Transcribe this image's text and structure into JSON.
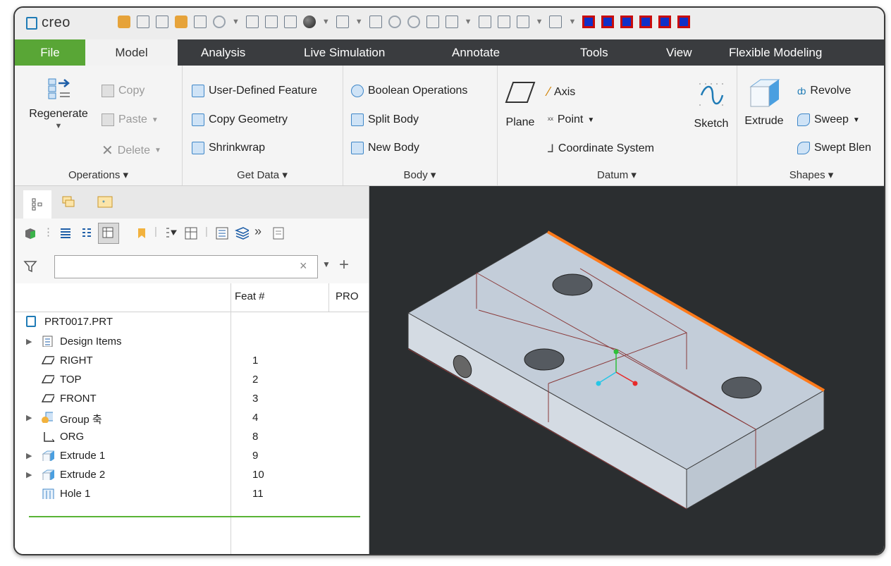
{
  "app": {
    "name": "creo"
  },
  "tabs": [
    {
      "label": "File"
    },
    {
      "label": "Model"
    },
    {
      "label": "Analysis"
    },
    {
      "label": "Live Simulation"
    },
    {
      "label": "Annotate"
    },
    {
      "label": "Tools"
    },
    {
      "label": "View"
    },
    {
      "label": "Flexible Modeling"
    }
  ],
  "ribbon": {
    "operations": {
      "regenerate": "Regenerate",
      "copy": "Copy",
      "paste": "Paste",
      "delete": "Delete",
      "group_label": "Operations"
    },
    "get_data": {
      "udf": "User-Defined Feature",
      "copy_geometry": "Copy Geometry",
      "shrinkwrap": "Shrinkwrap",
      "group_label": "Get Data"
    },
    "body": {
      "boolean": "Boolean Operations",
      "split": "Split Body",
      "new": "New Body",
      "group_label": "Body"
    },
    "datum": {
      "plane": "Plane",
      "axis": "Axis",
      "point": "Point",
      "coord": "Coordinate System",
      "sketch": "Sketch",
      "group_label": "Datum"
    },
    "shapes": {
      "extrude": "Extrude",
      "revolve": "Revolve",
      "sweep": "Sweep",
      "swept_blend": "Swept Blen",
      "group_label": "Shapes"
    }
  },
  "model_tree": {
    "search_placeholder": "",
    "columns": {
      "feat": "Feat #",
      "pro": "PRO"
    },
    "root": "PRT0017.PRT",
    "items": [
      {
        "label": "Design Items",
        "num": "",
        "icon": "design-items-icon"
      },
      {
        "label": "RIGHT",
        "num": "1",
        "icon": "datum-plane-icon"
      },
      {
        "label": "TOP",
        "num": "2",
        "icon": "datum-plane-icon"
      },
      {
        "label": "FRONT",
        "num": "3",
        "icon": "datum-plane-icon"
      },
      {
        "label": "Group 축",
        "num": "4",
        "icon": "group-icon"
      },
      {
        "label": "ORG",
        "num": "8",
        "icon": "csys-icon"
      },
      {
        "label": "Extrude 1",
        "num": "9",
        "icon": "extrude-icon"
      },
      {
        "label": "Extrude 2",
        "num": "10",
        "icon": "extrude-icon"
      },
      {
        "label": "Hole 1",
        "num": "11",
        "icon": "hole-icon"
      }
    ]
  },
  "colors": {
    "file_tab": "#59a636",
    "viewport_bg": "#2b2e30",
    "edge_highlight": "#ff7a1a"
  }
}
